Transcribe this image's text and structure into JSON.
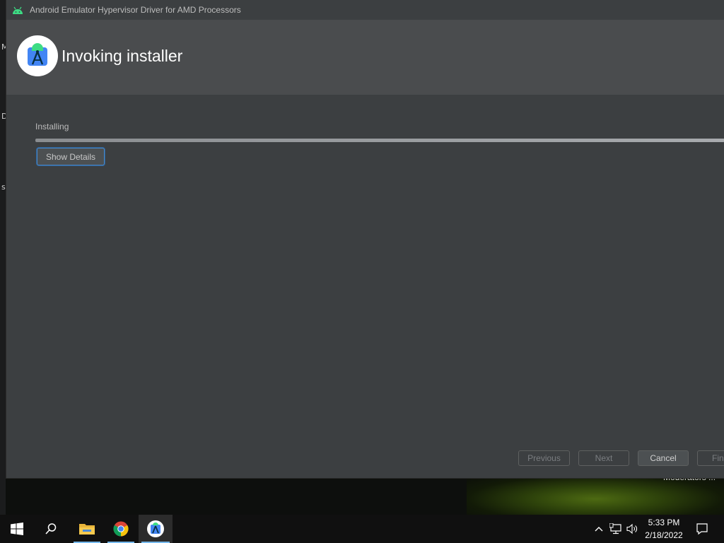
{
  "desktop": {
    "side_letters": [
      "M",
      "D",
      "s"
    ],
    "background_text": "Moderators ..."
  },
  "window": {
    "title": "Android Emulator Hypervisor Driver for AMD Processors",
    "app_icon": "android-icon",
    "header": {
      "logo": "android-studio-icon",
      "title": "Invoking installer"
    },
    "status_label": "Installing",
    "progress_percent": 100,
    "show_details_label": "Show Details",
    "buttons": {
      "previous": "Previous",
      "next": "Next",
      "cancel": "Cancel",
      "finish": "Finish"
    }
  },
  "taskbar": {
    "items": [
      "start-icon",
      "search-icon",
      "file-explorer-icon",
      "chrome-icon",
      "android-studio-icon"
    ],
    "clock": {
      "time": "5:33 PM",
      "date": "2/18/2022"
    }
  }
}
